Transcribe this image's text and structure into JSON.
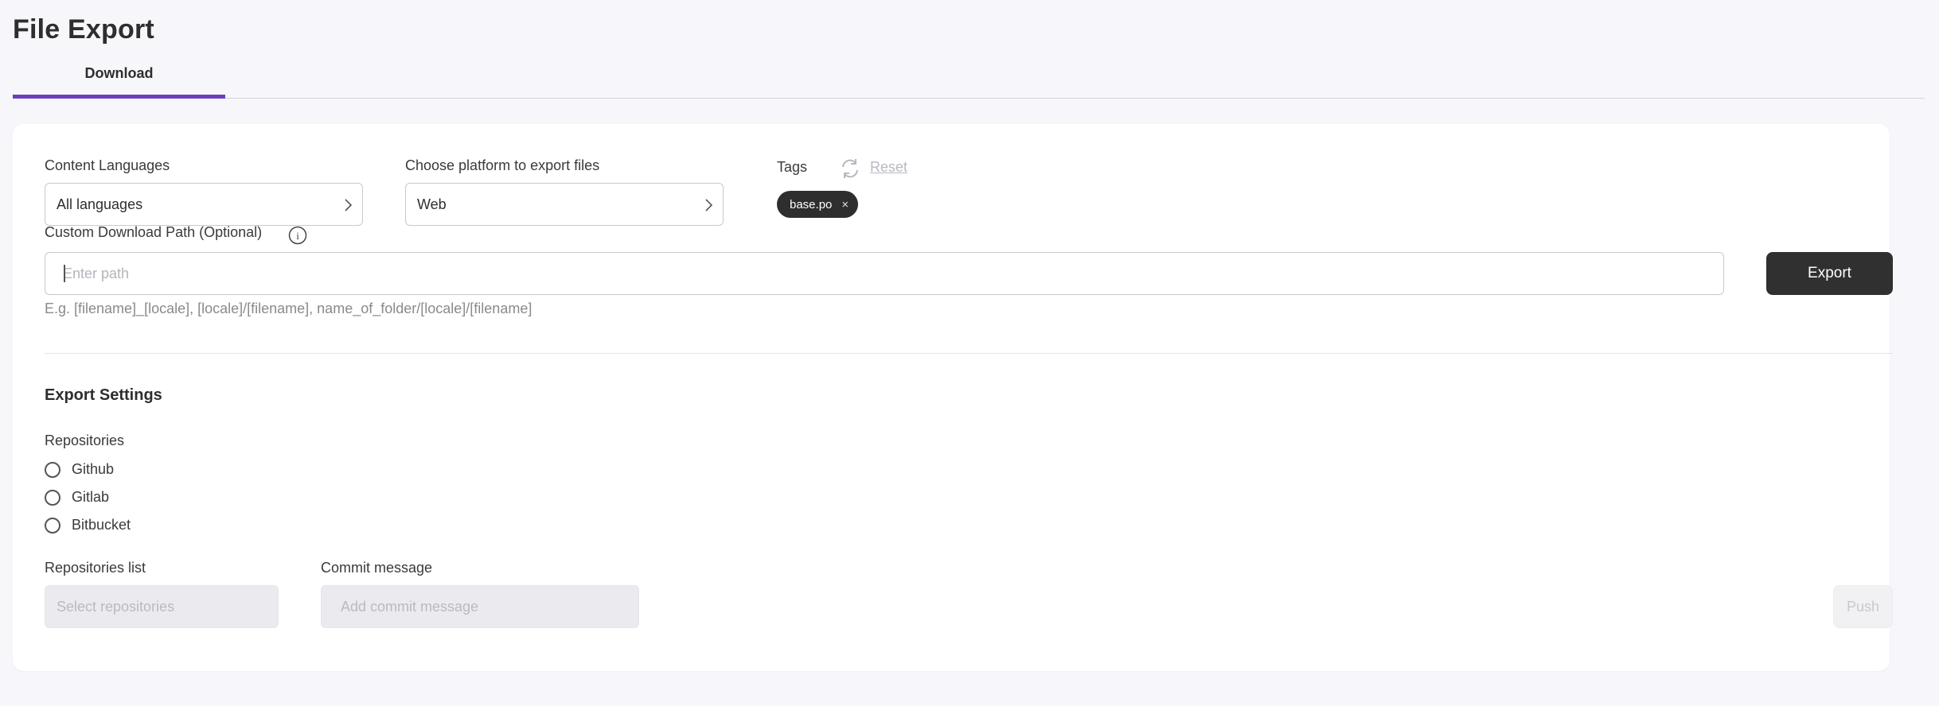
{
  "page": {
    "title": "File Export"
  },
  "tabs": [
    {
      "label": "Download"
    }
  ],
  "content_languages": {
    "label": "Content Languages",
    "value": "All languages"
  },
  "platform": {
    "label": "Choose platform to export files",
    "value": "Web"
  },
  "tags": {
    "label": "Tags",
    "reset_label": "Reset",
    "items": [
      {
        "label": "base.po",
        "remove": "×"
      }
    ]
  },
  "custom_path": {
    "label": "Custom Download Path (Optional)",
    "info_glyph": "i",
    "placeholder": "Enter path",
    "hint": "E.g. [filename]_[locale], [locale]/[filename], name_of_folder/[locale]/[filename]"
  },
  "export_button": {
    "label": "Export"
  },
  "export_settings": {
    "title": "Export Settings",
    "repositories_label": "Repositories",
    "options": [
      {
        "label": "Github"
      },
      {
        "label": "Gitlab"
      },
      {
        "label": "Bitbucket"
      }
    ],
    "repositories_list": {
      "label": "Repositories list",
      "placeholder": "Select repositories"
    },
    "commit_message": {
      "label": "Commit message",
      "placeholder": "Add commit message"
    },
    "push_label": "Push"
  },
  "colors": {
    "accent": "#6d3fc0",
    "primary_button": "#303030",
    "page_background": "#f7f7fb"
  }
}
